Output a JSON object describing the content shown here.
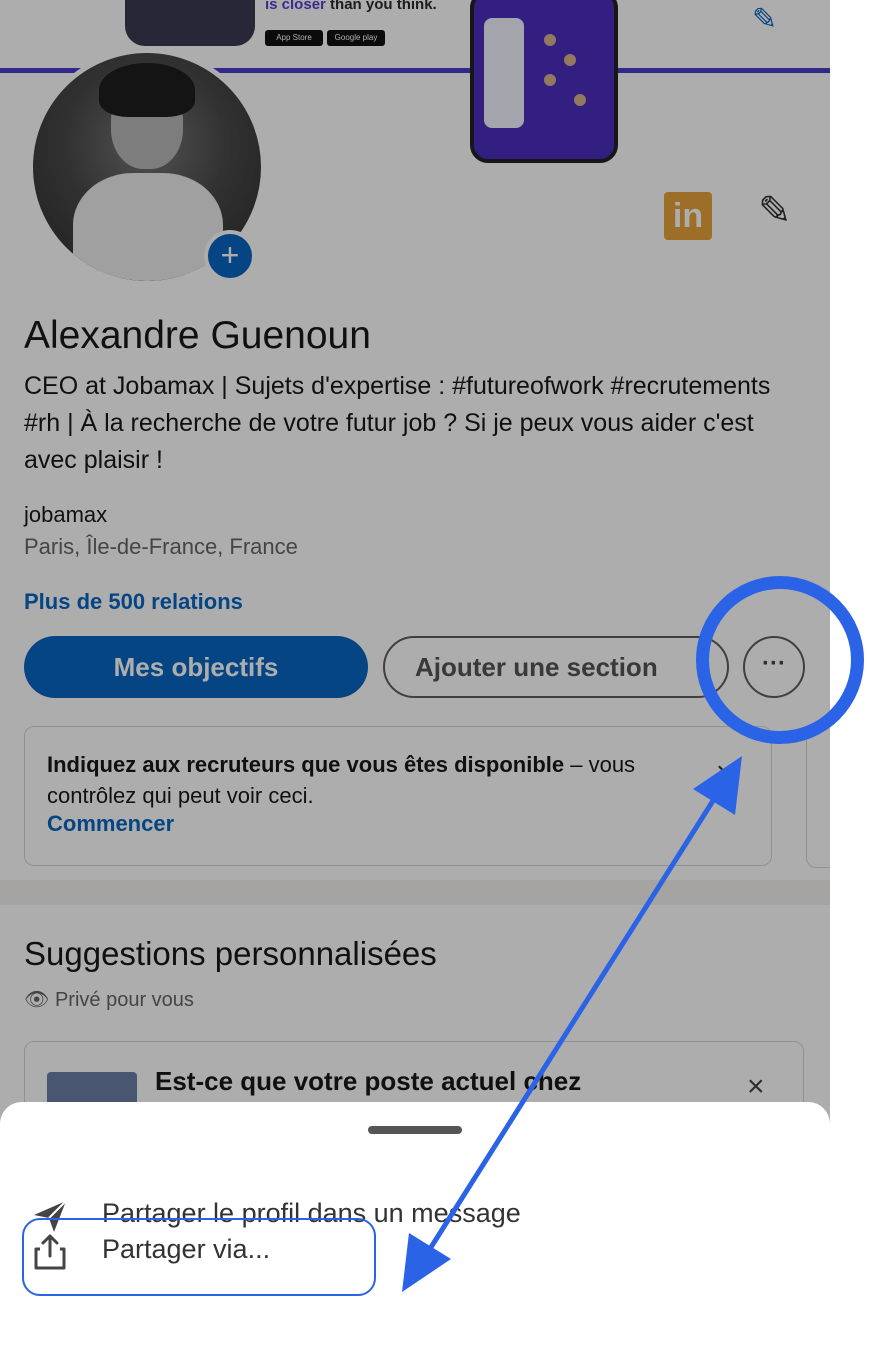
{
  "banner": {
    "tagline_prefix": "is closer",
    "tagline_suffix": " than you think.",
    "store_badges": [
      "App Store",
      "Google play"
    ]
  },
  "profile": {
    "name": "Alexandre Guenoun",
    "headline": "CEO at Jobamax | Sujets d'expertise : #futureofwork #recrutements #rh | À la recherche de votre futur job ? Si je peux vous aider c'est avec plaisir !",
    "company": "jobamax",
    "location": "Paris, Île-de-France, France",
    "connections": "Plus de 500 relations",
    "logo_text": "in"
  },
  "actions": {
    "primary_label": "Mes objectifs",
    "secondary_label": "Ajouter une section",
    "more_label": "···"
  },
  "recruiter_card": {
    "bold_text": "Indiquez aux recruteurs que vous êtes disponible",
    "rest_text": " – vous contrôlez qui peut voir ceci.",
    "cta": "Commencer",
    "close": "×"
  },
  "suggestions": {
    "title": "Suggestions personnalisées",
    "private_label": "Privé pour vous",
    "card_text": "Est-ce que votre poste actuel chez",
    "close": "×"
  },
  "bottom_sheet": {
    "items": [
      {
        "label": "Partager le profil dans un message",
        "icon": "send-icon"
      },
      {
        "label": "Partager via...",
        "icon": "share-icon"
      }
    ]
  },
  "colors": {
    "linkedin_blue": "#0a66c2",
    "annotation_blue": "#2b63e6",
    "overlay": "rgba(0,0,0,0.32)"
  }
}
